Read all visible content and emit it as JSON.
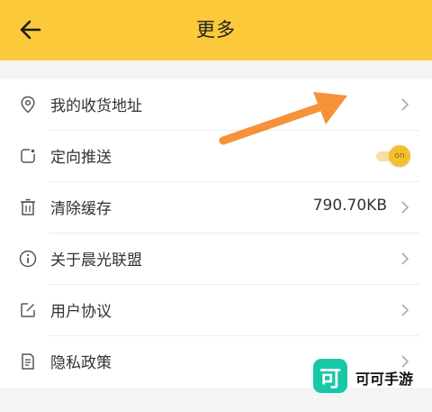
{
  "header": {
    "title": "更多",
    "back_icon": "arrow-left-icon",
    "background": "#fcc93b"
  },
  "menu": {
    "items": [
      {
        "label": "我的收货地址",
        "icon": "location-pin-icon"
      },
      {
        "label": "定向推送",
        "icon": "push-icon",
        "toggle": {
          "state": "on",
          "label": "on"
        }
      },
      {
        "label": "清除缓存",
        "icon": "trash-icon",
        "value": "790.70KB"
      },
      {
        "label": "关于晨光联盟",
        "icon": "info-icon"
      },
      {
        "label": "用户协议",
        "icon": "edit-icon"
      },
      {
        "label": "隐私政策",
        "icon": "document-icon"
      }
    ]
  },
  "annotation": {
    "color": "#f5923a"
  },
  "watermark": {
    "logo_text": "可",
    "text": "可可手游"
  }
}
